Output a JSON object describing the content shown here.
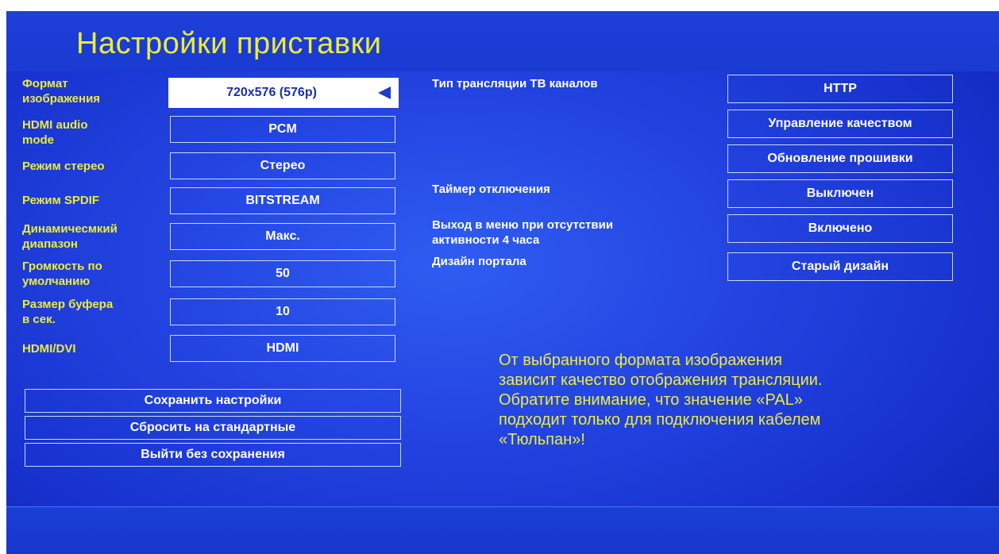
{
  "title": "Настройки приставки",
  "left_settings": [
    {
      "label": [
        "Формат",
        "изображения"
      ],
      "value": "720x576 (576p)",
      "selected": true
    },
    {
      "label": [
        "HDMI audio",
        "mode"
      ],
      "value": "PCM"
    },
    {
      "label": [
        "Режим стерео"
      ],
      "value": "Стерео"
    },
    {
      "label": [
        "Режим SPDIF"
      ],
      "value": "BITSTREAM"
    },
    {
      "label": [
        "Динамичесмкий",
        "диапазон"
      ],
      "value": "Макс."
    },
    {
      "label": [
        "Громкость по",
        "умолчанию"
      ],
      "value": "50"
    },
    {
      "label": [
        "Размер буфера",
        "в сек."
      ],
      "value": "10"
    },
    {
      "label": [
        "HDMI/DVI"
      ],
      "value": "HDMI"
    }
  ],
  "right_settings": [
    {
      "label": [
        "Тип трансляции ТВ каналов"
      ],
      "value": "HTTP"
    },
    {
      "label": [],
      "value": "Управление качеством"
    },
    {
      "label": [],
      "value": "Обновление прошивки"
    },
    {
      "label": [
        "Таймер отключения"
      ],
      "value": "Выключен"
    },
    {
      "label": [
        "Выход в меню при отсутствии",
        "активности 4 часа"
      ],
      "value": "Включено"
    },
    {
      "label": [
        "Дизайн портала"
      ],
      "value": "Старый дизайн"
    }
  ],
  "buttons": {
    "save": "Сохранить настройки",
    "reset": "Сбросить на стандартные",
    "exit": "Выйти без сохранения"
  },
  "hint": [
    "От выбранного формата изображения",
    "зависит качество отображения трансляции.",
    "Обратите внимание, что значение «PAL»",
    "подходит только для подключения кабелем",
    "«Тюльпан»!"
  ],
  "colors": {
    "background": "#2547e4",
    "label_yellow": "#ecec3a",
    "border": "#c8d6ff",
    "selected_field": "#ffffff"
  }
}
